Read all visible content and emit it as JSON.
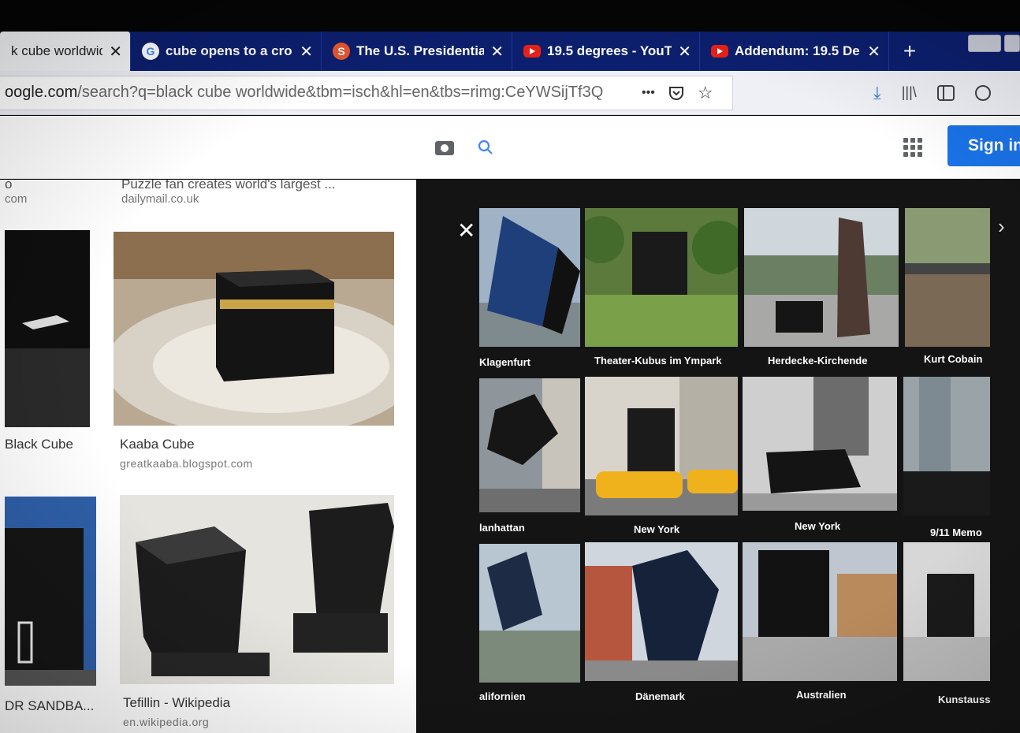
{
  "tabs": [
    {
      "title": "k cube worldwid",
      "favicon": "none",
      "active": true
    },
    {
      "title": "cube opens to a cro",
      "favicon": "google-icon",
      "active": false
    },
    {
      "title": "The U.S. Presidentia",
      "favicon": "sumo-icon",
      "active": false
    },
    {
      "title": "19.5 degrees - YouT",
      "favicon": "youtube-icon",
      "active": false
    },
    {
      "title": "Addendum: 19.5 De",
      "favicon": "youtube-icon",
      "active": false
    }
  ],
  "tab_close_glyph": "✕",
  "new_tab_glyph": "+",
  "url": {
    "host": "oogle.com",
    "path": "/search?q=black cube worldwide&tbm=isch&hl=en&tbs=rimg:CeYWSijTf3Q"
  },
  "nav_icons": {
    "more": "•••",
    "pocket": "pocket-icon",
    "star": "☆",
    "download": "⤓",
    "library": "|||\\",
    "sidebar": "sidebar-icon"
  },
  "header": {
    "sign_in": "Sign in"
  },
  "results": {
    "top_left_cut": "o",
    "top_left_src": "com",
    "top_right_cut": "Puzzle fan creates world's largest ...",
    "top_right_src": "dailymail.co.uk",
    "items": [
      {
        "title": "Black Cube",
        "source": ""
      },
      {
        "title": "Kaaba Cube",
        "source": "greatkaaba.blogspot.com"
      },
      {
        "title": "DR SANDBA...",
        "source": ""
      },
      {
        "title": "Tefillin - Wikipedia",
        "source": "en.wikipedia.org"
      }
    ]
  },
  "viewer": {
    "close": "✕",
    "prev": "‹",
    "next": "›",
    "tiles": [
      {
        "label": "Klagenfurt"
      },
      {
        "label": "Theater-Kubus im Ympark"
      },
      {
        "label": "Herdecke-Kirchende"
      },
      {
        "label": "Kurt Cobain"
      },
      {
        "label": "lanhattan"
      },
      {
        "label": "New York"
      },
      {
        "label": "New York"
      },
      {
        "label": "9/11 Memo"
      },
      {
        "label": "alifornien"
      },
      {
        "label": "Dänemark"
      },
      {
        "label": "Australien"
      },
      {
        "label": "Kunstauss"
      }
    ]
  },
  "colors": {
    "tabstrip": "#0c1f6e",
    "signin": "#1a73e8",
    "viewer_bg": "#141414"
  }
}
